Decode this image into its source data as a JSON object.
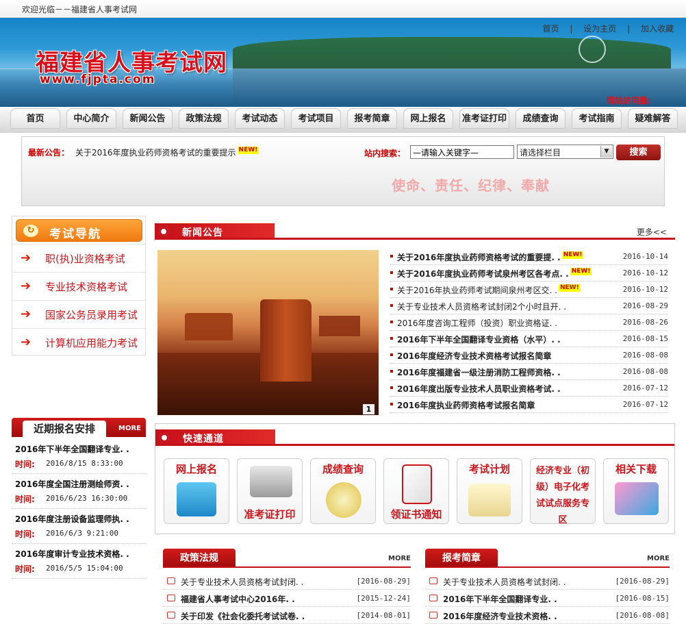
{
  "topbar": {
    "welcome": "欢迎光临－－福建省人事考试网"
  },
  "header": {
    "links": [
      "首页",
      "|",
      "设为主页",
      "|",
      "加入收藏"
    ],
    "logo": "福建省人事考试网",
    "logo_url": "www.fjpta.com",
    "visit_label": "网站访问量:"
  },
  "nav": [
    "首页",
    "中心简介",
    "新闻公告",
    "政策法规",
    "考试动态",
    "考试项目",
    "报考简章",
    "网上报名",
    "准考证打印",
    "成绩查询",
    "考试指南",
    "疑难解答"
  ],
  "notice": {
    "label": "最新公告：",
    "text": "关于2016年度执业药师资格考试的重要提示",
    "badge": "NEW!",
    "search_label": "站内搜索：",
    "search_value": "—请输入关键字—",
    "select_value": "请选择栏目",
    "search_button": "搜索",
    "slogan": "使命、责任、纪律、奉献"
  },
  "exam_nav": {
    "title": "考试导航",
    "items": [
      "职(执)业资格考试",
      "专业技术资格考试",
      "国家公务员录用考试",
      "计算机应用能力考试"
    ]
  },
  "schedule": {
    "title": "近期报名安排",
    "more": "MORE",
    "time_label": "时间:",
    "items": [
      {
        "name": "2016年下半年全国翻译专业. .",
        "time": "2016/8/15 8:33:00"
      },
      {
        "name": "2016年度全国注册测绘师资. .",
        "time": "2016/6/23 16:30:00"
      },
      {
        "name": "2016年度注册设备监理师执. .",
        "time": "2016/6/3 9:21:00"
      },
      {
        "name": "2016年度审计专业技术资格. .",
        "time": "2016/5/5 15:04:00"
      }
    ]
  },
  "news": {
    "title": "新闻公告",
    "more": "更多<<",
    "image_index": "1",
    "items": [
      {
        "title": "关于2016年度执业药师资格考试的重要提. .",
        "date": "2016-10-14",
        "bold": true,
        "new": true
      },
      {
        "title": "关于2016年度执业药师考试泉州考区各考点. .",
        "date": "2016-10-12",
        "bold": true,
        "new": true
      },
      {
        "title": "关于2016年执业药师考试期间泉州考区交. .",
        "date": "2016-10-12",
        "bold": false,
        "new": true
      },
      {
        "title": "关于专业技术人员资格考试封闭2个小时且开. .",
        "date": "2016-08-29",
        "bold": false,
        "new": false
      },
      {
        "title": "2016年度咨询工程师（投资）职业资格证. .",
        "date": "2016-08-26",
        "bold": false,
        "new": false
      },
      {
        "title": "2016年下半年全国翻译专业资格（水平）. .",
        "date": "2016-08-15",
        "bold": true,
        "new": false
      },
      {
        "title": "2016年度经济专业技术资格考试报名简章",
        "date": "2016-08-08",
        "bold": true,
        "new": false
      },
      {
        "title": "2016年度福建省一级注册消防工程师资格. .",
        "date": "2016-08-08",
        "bold": true,
        "new": false
      },
      {
        "title": "2016年度出版专业技术人员职业资格考试. .",
        "date": "2016-07-12",
        "bold": true,
        "new": false
      },
      {
        "title": "2016年度执业药师资格考试报名简章",
        "date": "2016-07-12",
        "bold": true,
        "new": false
      }
    ],
    "badge": "NEW!"
  },
  "quick": {
    "title": "快速通道",
    "items": [
      "网上报名",
      "准考证打印",
      "成绩查询",
      "领证书通知",
      "考试计划",
      "经济专业（初级）电子化考试试点服务专区",
      "相关下载"
    ]
  },
  "policy": {
    "title": "政策法规",
    "more": "MORE",
    "items": [
      {
        "title": "关于专业技术人员资格考试封闭. .",
        "date": "[2016-08-29]",
        "bold": false
      },
      {
        "title": "福建省人事考试中心2016年. .",
        "date": "[2015-12-24]",
        "bold": true
      },
      {
        "title": "关于印发《社会化委托考试试卷. .",
        "date": "[2014-08-01]",
        "bold": true
      }
    ]
  },
  "brochure": {
    "title": "报考简章",
    "more": "MORE",
    "items": [
      {
        "title": "关于专业技术人员资格考试封闭. .",
        "date": "[2016-08-29]",
        "bold": false
      },
      {
        "title": "2016年下半年全国翻译专业. .",
        "date": "[2016-08-15]",
        "bold": true
      },
      {
        "title": "2016年度经济专业技术资格. .",
        "date": "[2016-08-08]",
        "bold": true
      }
    ]
  },
  "colors": {
    "brand_red": "#c8161d",
    "accent_orange": "#ef7a10",
    "banner_blue": "#1583c8"
  }
}
